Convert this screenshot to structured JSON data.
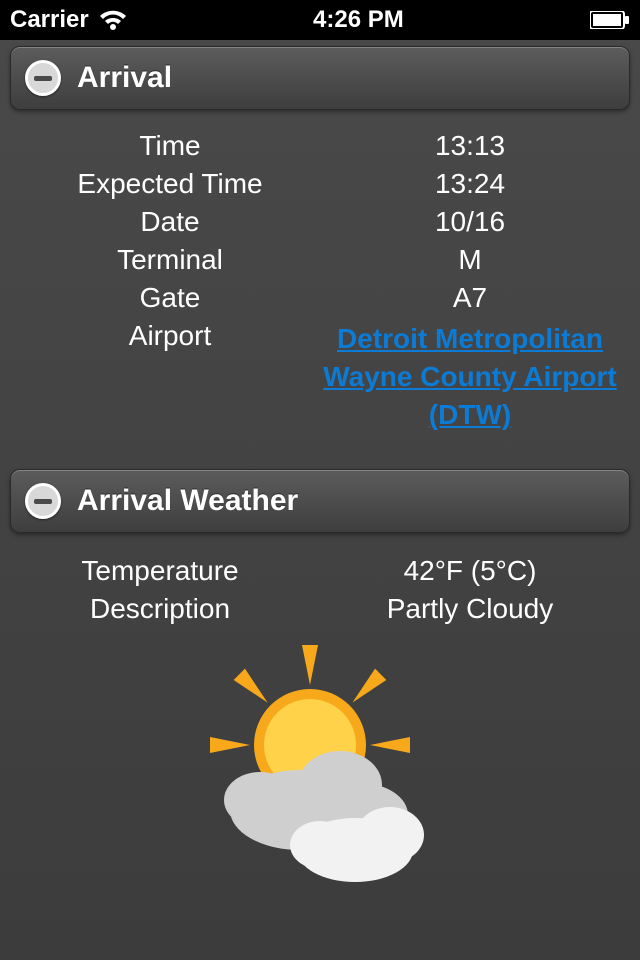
{
  "statusbar": {
    "carrier": "Carrier",
    "time": "4:26 PM"
  },
  "arrival": {
    "header": "Arrival",
    "labels": {
      "time": "Time",
      "expected_time": "Expected Time",
      "date": "Date",
      "terminal": "Terminal",
      "gate": "Gate",
      "airport": "Airport"
    },
    "values": {
      "time": "13:13",
      "expected_time": "13:24",
      "date": "10/16",
      "terminal": "M",
      "gate": "A7",
      "airport": "Detroit Metropolitan Wayne County Airport (DTW)"
    }
  },
  "weather": {
    "header": "Arrival Weather",
    "labels": {
      "temperature": "Temperature",
      "description": "Description"
    },
    "values": {
      "temperature": "42°F (5°C)",
      "description": "Partly Cloudy"
    }
  }
}
